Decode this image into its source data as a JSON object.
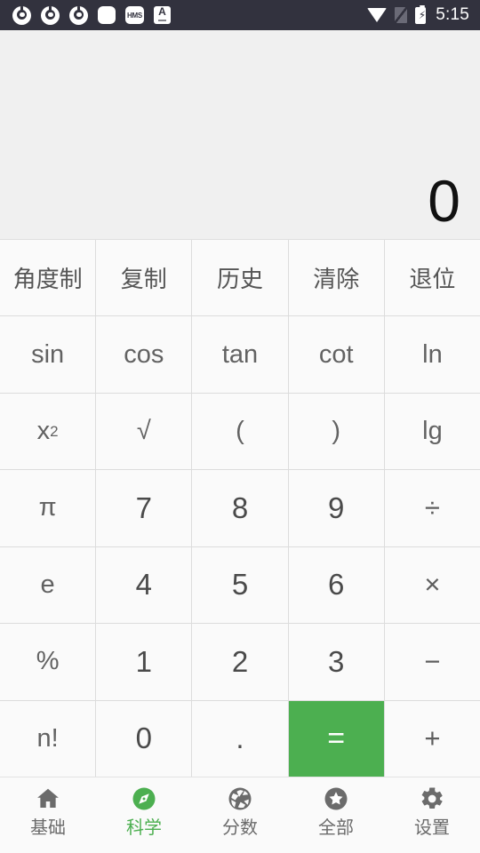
{
  "status_bar": {
    "background": "#32323e",
    "time": "5:15",
    "left_icons": [
      {
        "name": "chrome-icon",
        "label": "Chrome"
      },
      {
        "name": "chrome-icon",
        "label": "Chrome"
      },
      {
        "name": "chrome-icon",
        "label": "Chrome"
      },
      {
        "name": "rounded-square-icon",
        "label": ""
      },
      {
        "name": "hms-icon",
        "label": "HMS"
      },
      {
        "name": "a-letter-icon",
        "label": "A"
      }
    ],
    "right_icons": [
      {
        "name": "wifi-icon",
        "label": "Wi-Fi"
      },
      {
        "name": "sim-off-icon",
        "label": "No SIM"
      },
      {
        "name": "battery-charging-icon",
        "label": "Charging"
      }
    ]
  },
  "display": {
    "expression": "",
    "result": "0",
    "background": "#f0f0f0"
  },
  "keypad": {
    "accent": "#4caf50",
    "rows": [
      [
        {
          "label": "角度制",
          "kind": "cjk",
          "name": "key-degree-mode"
        },
        {
          "label": "复制",
          "kind": "cjk",
          "name": "key-copy"
        },
        {
          "label": "历史",
          "kind": "cjk",
          "name": "key-history"
        },
        {
          "label": "清除",
          "kind": "cjk",
          "name": "key-clear"
        },
        {
          "label": "退位",
          "kind": "cjk",
          "name": "key-backspace"
        }
      ],
      [
        {
          "label": "sin",
          "kind": "fn",
          "name": "key-sin"
        },
        {
          "label": "cos",
          "kind": "fn",
          "name": "key-cos"
        },
        {
          "label": "tan",
          "kind": "fn",
          "name": "key-tan"
        },
        {
          "label": "cot",
          "kind": "fn",
          "name": "key-cot"
        },
        {
          "label": "ln",
          "kind": "fn",
          "name": "key-ln"
        }
      ],
      [
        {
          "label": "x2",
          "kind": "sup",
          "name": "key-square",
          "base": "x",
          "exponent": "2"
        },
        {
          "label": "√",
          "kind": "fn",
          "name": "key-sqrt"
        },
        {
          "label": "(",
          "kind": "fn",
          "name": "key-paren-open"
        },
        {
          "label": ")",
          "kind": "fn",
          "name": "key-paren-close"
        },
        {
          "label": "lg",
          "kind": "fn",
          "name": "key-lg"
        }
      ],
      [
        {
          "label": "π",
          "kind": "fn",
          "name": "key-pi"
        },
        {
          "label": "7",
          "kind": "num",
          "name": "key-7"
        },
        {
          "label": "8",
          "kind": "num",
          "name": "key-8"
        },
        {
          "label": "9",
          "kind": "num",
          "name": "key-9"
        },
        {
          "label": "÷",
          "kind": "op",
          "name": "key-divide"
        }
      ],
      [
        {
          "label": "e",
          "kind": "fn",
          "name": "key-e"
        },
        {
          "label": "4",
          "kind": "num",
          "name": "key-4"
        },
        {
          "label": "5",
          "kind": "num",
          "name": "key-5"
        },
        {
          "label": "6",
          "kind": "num",
          "name": "key-6"
        },
        {
          "label": "×",
          "kind": "op",
          "name": "key-multiply"
        }
      ],
      [
        {
          "label": "%",
          "kind": "fn",
          "name": "key-percent"
        },
        {
          "label": "1",
          "kind": "num",
          "name": "key-1"
        },
        {
          "label": "2",
          "kind": "num",
          "name": "key-2"
        },
        {
          "label": "3",
          "kind": "num",
          "name": "key-3"
        },
        {
          "label": "−",
          "kind": "op",
          "name": "key-minus"
        }
      ],
      [
        {
          "label": "n!",
          "kind": "fn",
          "name": "key-factorial"
        },
        {
          "label": "0",
          "kind": "num",
          "name": "key-0"
        },
        {
          "label": ".",
          "kind": "dot",
          "name": "key-decimal-point"
        },
        {
          "label": "=",
          "kind": "equals",
          "name": "key-equals"
        },
        {
          "label": "+",
          "kind": "op",
          "name": "key-plus"
        }
      ]
    ]
  },
  "bottom_nav": {
    "active_index": 1,
    "active_color": "#4caf50",
    "inactive_color": "#6b6b6b",
    "items": [
      {
        "label": "基础",
        "icon": "home-icon",
        "name": "nav-item-basic"
      },
      {
        "label": "科学",
        "icon": "compass-icon",
        "name": "nav-item-scientific"
      },
      {
        "label": "分数",
        "icon": "aperture-icon",
        "name": "nav-item-fraction"
      },
      {
        "label": "全部",
        "icon": "star-circle-icon",
        "name": "nav-item-all"
      },
      {
        "label": "设置",
        "icon": "gear-icon",
        "name": "nav-item-settings"
      }
    ]
  }
}
